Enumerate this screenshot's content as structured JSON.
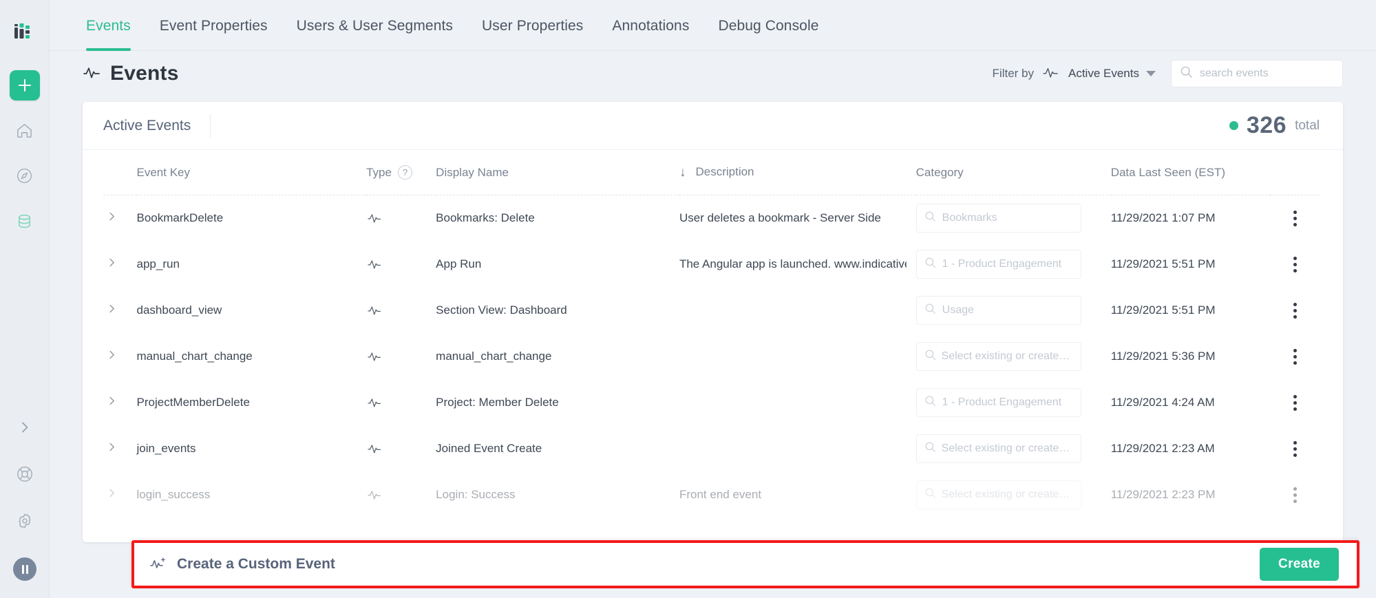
{
  "sidebar": {
    "logo_name": "indicative-logo",
    "items": [
      {
        "name": "add-button",
        "icon": "plus-icon",
        "label": "Add"
      },
      {
        "name": "home",
        "icon": "home-icon",
        "label": "Home"
      },
      {
        "name": "explore",
        "icon": "compass-icon",
        "label": "Explore"
      },
      {
        "name": "data",
        "icon": "database-icon",
        "label": "Data"
      }
    ],
    "bottom_items": [
      {
        "name": "expand",
        "icon": "chevron-right-icon",
        "label": "Expand"
      },
      {
        "name": "support",
        "icon": "lifebuoy-icon",
        "label": "Support"
      },
      {
        "name": "settings",
        "icon": "gear-icon",
        "label": "Settings"
      },
      {
        "name": "pause",
        "icon": "pause-icon",
        "label": "Pause"
      }
    ]
  },
  "tabs": [
    {
      "label": "Events",
      "active": true
    },
    {
      "label": "Event Properties",
      "active": false
    },
    {
      "label": "Users & User Segments",
      "active": false
    },
    {
      "label": "User Properties",
      "active": false
    },
    {
      "label": "Annotations",
      "active": false
    },
    {
      "label": "Debug Console",
      "active": false
    }
  ],
  "header": {
    "title": "Events",
    "title_icon": "pulse-icon",
    "filter_by_label": "Filter by",
    "filter_icon": "pulse-icon",
    "filter_value": "Active Events",
    "search_placeholder": "search events",
    "search_value": "",
    "search_icon": "search-icon"
  },
  "card": {
    "section_label": "Active Events",
    "total_count": "326",
    "total_label": "total",
    "status_color": "#2bbd90"
  },
  "table": {
    "columns": [
      {
        "key": "caret",
        "label": ""
      },
      {
        "key": "event_key",
        "label": "Event Key"
      },
      {
        "key": "type",
        "label": "Type"
      },
      {
        "key": "display_name",
        "label": "Display Name"
      },
      {
        "key": "description",
        "label": "Description"
      },
      {
        "key": "category",
        "label": "Category"
      },
      {
        "key": "data_last_seen",
        "label": "Data Last Seen (EST)"
      }
    ],
    "type_help_badge": "?",
    "sorted_column": "Description",
    "sort_direction_glyph": "↓",
    "rows": [
      {
        "event_key": "BookmarkDelete",
        "type_icon": "pulse-icon",
        "display_name": "Bookmarks: Delete",
        "description": "User deletes a bookmark - Server Side",
        "category": "Bookmarks",
        "data_last_seen": "11/29/2021 1:07 PM"
      },
      {
        "event_key": "app_run",
        "type_icon": "pulse-icon",
        "display_name": "App Run",
        "description": "The Angular app is launched. www.indicative.",
        "category": "1 - Product Engagement",
        "data_last_seen": "11/29/2021 5:51 PM"
      },
      {
        "event_key": "dashboard_view",
        "type_icon": "pulse-icon",
        "display_name": "Section View: Dashboard",
        "description": "",
        "category": "Usage",
        "data_last_seen": "11/29/2021 5:51 PM"
      },
      {
        "event_key": "manual_chart_change",
        "type_icon": "pulse-icon",
        "display_name": "manual_chart_change",
        "description": "",
        "category": "Select existing or create new",
        "data_last_seen": "11/29/2021 5:36 PM"
      },
      {
        "event_key": "ProjectMemberDelete",
        "type_icon": "pulse-icon",
        "display_name": "Project: Member Delete",
        "description": "",
        "category": "1 - Product Engagement",
        "data_last_seen": "11/29/2021 4:24 AM"
      },
      {
        "event_key": "join_events",
        "type_icon": "pulse-icon",
        "display_name": "Joined Event Create",
        "description": "",
        "category": "Select existing or create new",
        "data_last_seen": "11/29/2021 2:23 AM"
      },
      {
        "event_key": "login_success",
        "type_icon": "pulse-icon",
        "display_name": "Login: Success",
        "description": "Front end event",
        "category": "Select existing or create new",
        "data_last_seen": "11/29/2021 2:23 PM"
      }
    ],
    "row_menu_icon": "kebab-menu-icon",
    "row_expand_icon": "chevron-right-icon",
    "category_search_icon": "search-icon"
  },
  "bottom_bar": {
    "icon": "create-event-icon",
    "label": "Create a Custom Event",
    "create_button": "Create",
    "highlight_color": "#f41a1a",
    "button_color": "#26bf92"
  }
}
